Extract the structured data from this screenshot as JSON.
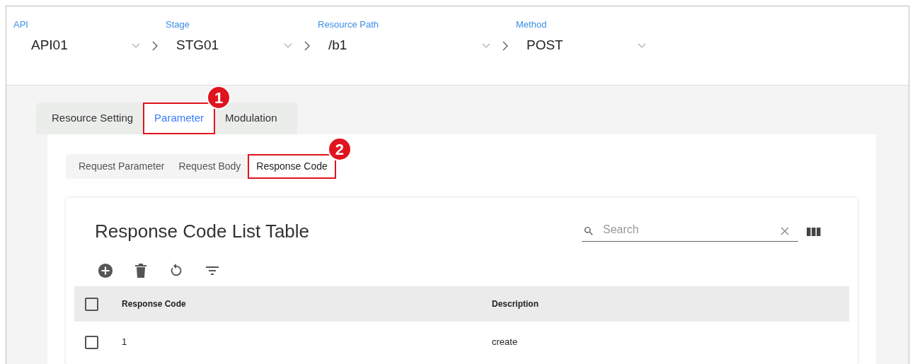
{
  "selectors": [
    {
      "label": "API",
      "value": "API01"
    },
    {
      "label": "Stage",
      "value": "STG01"
    },
    {
      "label": "Resource Path",
      "value": "/b1"
    },
    {
      "label": "Method",
      "value": "POST"
    }
  ],
  "tabs": [
    {
      "label": "Resource Setting",
      "selected": false
    },
    {
      "label": "Parameter",
      "selected": true,
      "callout": "1"
    },
    {
      "label": "Modulation",
      "selected": false
    }
  ],
  "subtabs": [
    {
      "label": "Request Parameter",
      "selected": false
    },
    {
      "label": "Request Body",
      "selected": false
    },
    {
      "label": "Response Code",
      "selected": true,
      "callout": "2"
    }
  ],
  "table": {
    "title": "Response Code List Table",
    "search": {
      "placeholder": "Search"
    },
    "columns": [
      "Response Code",
      "Description"
    ],
    "header_checked": false,
    "rows": [
      {
        "checked": false,
        "cells": [
          "1",
          "create"
        ]
      }
    ]
  }
}
